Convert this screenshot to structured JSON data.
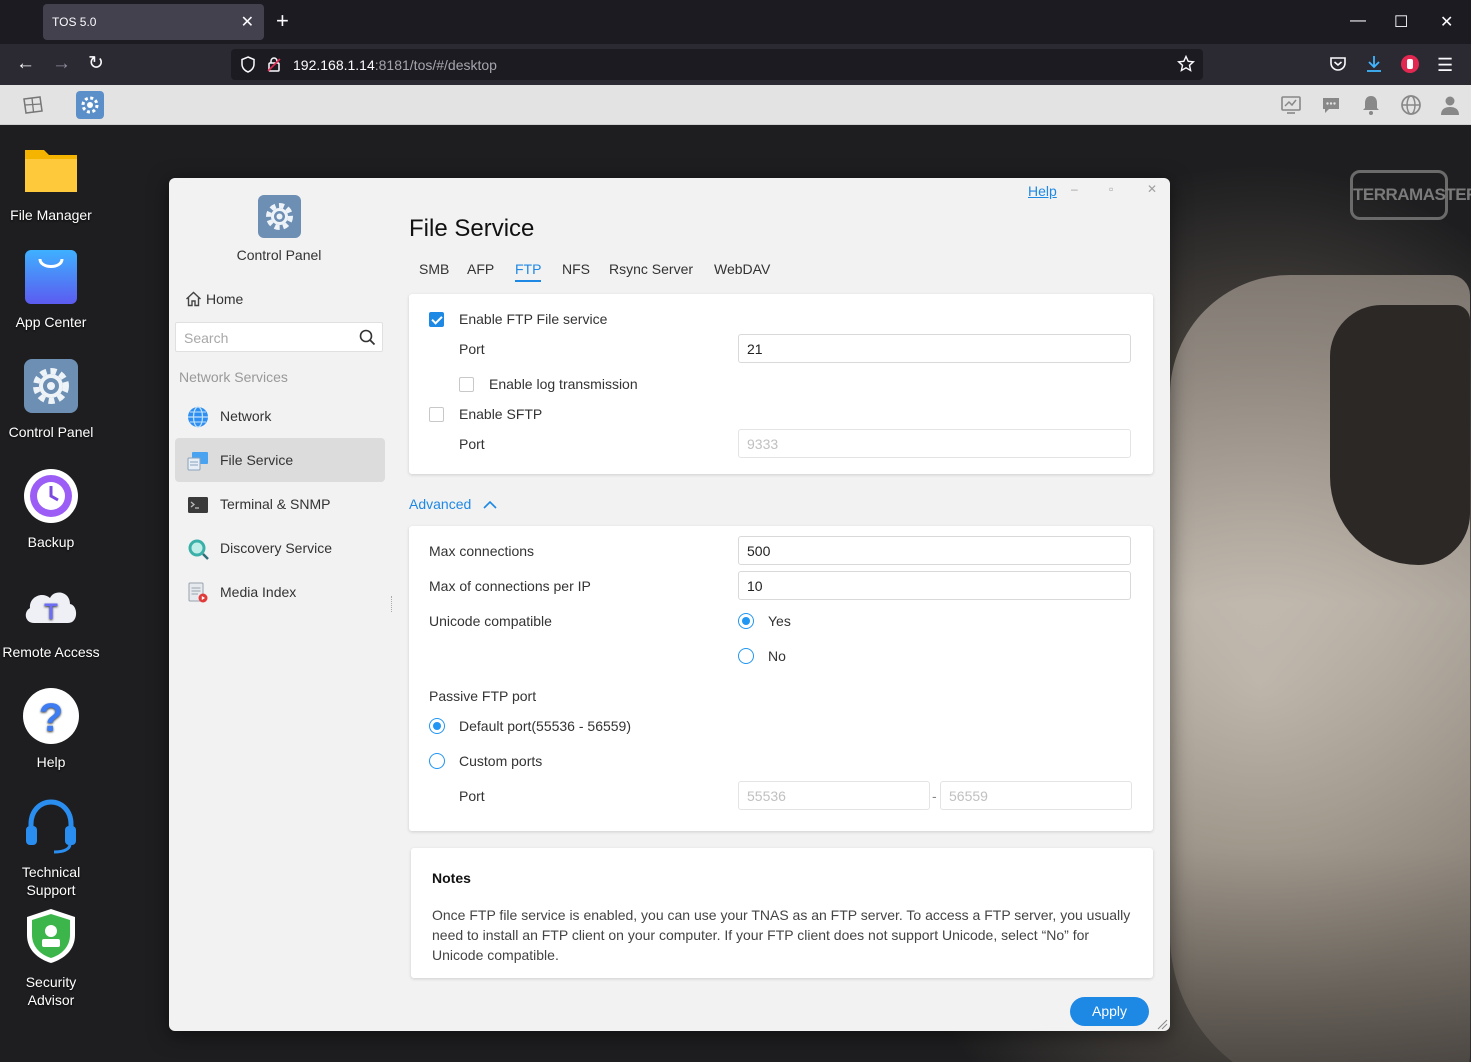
{
  "browser": {
    "tab_title": "TOS 5.0",
    "url_host": "192.168.1.14",
    "url_rest": ":8181/tos/#/desktop"
  },
  "desktop_icons": [
    {
      "label": "File Manager"
    },
    {
      "label": "App Center"
    },
    {
      "label": "Control Panel"
    },
    {
      "label": "Backup"
    },
    {
      "label": "Remote Access"
    },
    {
      "label": "Help"
    },
    {
      "label": "Technical Support"
    },
    {
      "label": "Security Advisor"
    }
  ],
  "brand_watermark": "TERRAMASTER",
  "window": {
    "help_link": "Help",
    "app_title": "Control Panel",
    "home_label": "Home",
    "search_placeholder": "Search",
    "section_label": "Network Services",
    "nav": [
      {
        "label": "Network",
        "icon": "globe-icon"
      },
      {
        "label": "File Service",
        "icon": "file-service-icon",
        "active": true
      },
      {
        "label": "Terminal & SNMP",
        "icon": "terminal-icon"
      },
      {
        "label": "Discovery Service",
        "icon": "discovery-icon"
      },
      {
        "label": "Media Index",
        "icon": "media-index-icon"
      }
    ],
    "main_title": "File Service",
    "tabs": [
      "SMB",
      "AFP",
      "FTP",
      "NFS",
      "Rsync Server",
      "WebDAV"
    ],
    "active_tab": "FTP",
    "ftp": {
      "enable_ftp_label": "Enable FTP File service",
      "enable_ftp_checked": true,
      "port_label": "Port",
      "port_value": "21",
      "enable_log_label": "Enable log transmission",
      "enable_log_checked": false,
      "enable_sftp_label": "Enable SFTP",
      "enable_sftp_checked": false,
      "sftp_port_label": "Port",
      "sftp_port_placeholder": "9333"
    },
    "advanced_label": "Advanced",
    "advanced": {
      "max_conn_label": "Max connections",
      "max_conn_value": "500",
      "max_conn_ip_label": "Max of connections per IP",
      "max_conn_ip_value": "10",
      "unicode_label": "Unicode compatible",
      "unicode_yes": "Yes",
      "unicode_no": "No",
      "unicode_selected": "Yes",
      "passive_label": "Passive FTP port",
      "default_port_label": "Default port(55536 - 56559)",
      "custom_ports_label": "Custom ports",
      "passive_selected": "Default port(55536 - 56559)",
      "port_label": "Port",
      "port_from_placeholder": "55536",
      "port_sep": "-",
      "port_to_placeholder": "56559"
    },
    "notes": {
      "title": "Notes",
      "text": "Once FTP file service is enabled, you can use your TNAS as an FTP server. To access a FTP server, you usually need to install an FTP client on your computer. If your FTP client does not support Unicode, select “No” for Unicode compatible."
    },
    "apply_label": "Apply"
  },
  "colors": {
    "accent": "#1e88e5",
    "window_bg": "#f2f2f2"
  }
}
